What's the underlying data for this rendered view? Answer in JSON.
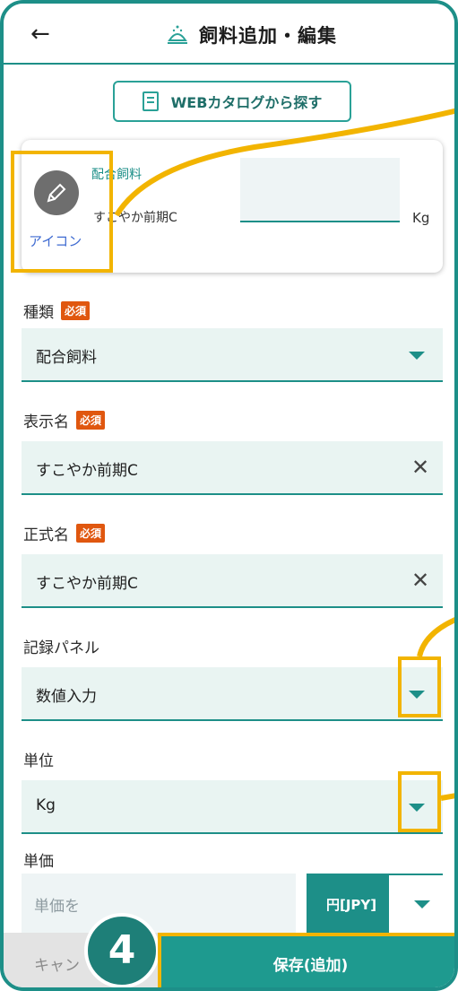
{
  "header": {
    "back_symbol": "←",
    "title": "飼料追加・編集",
    "title_icon": "feed-bowl-icon"
  },
  "catalog_button": {
    "label": "WEBカタログから探す",
    "icon": "catalog-book-icon"
  },
  "feed_card": {
    "icon_label": "アイコン",
    "type": "配合飼料",
    "name": "すこやか前期C",
    "unit": "Kg"
  },
  "fields": {
    "kind": {
      "label": "種類",
      "required_badge": "必須",
      "value": "配合飼料"
    },
    "display_name": {
      "label": "表示名",
      "required_badge": "必須",
      "value": "すこやか前期C",
      "clear_symbol": "✕"
    },
    "official_name": {
      "label": "正式名",
      "required_badge": "必須",
      "value": "すこやか前期C",
      "clear_symbol": "✕"
    },
    "record_panel": {
      "label": "記録パネル",
      "value": "数値入力"
    },
    "unit": {
      "label": "単位",
      "value": "Kg"
    },
    "price": {
      "label": "単価",
      "placeholder": "単価を",
      "currency": "円[JPY]"
    }
  },
  "footer": {
    "cancel_label": "キャン",
    "save_label": "保存(追加)"
  },
  "step_badge": "4",
  "colors": {
    "accent": "#1d8f88",
    "required": "#e0570f",
    "highlight": "#f2b400",
    "save": "#1e9a8f"
  }
}
